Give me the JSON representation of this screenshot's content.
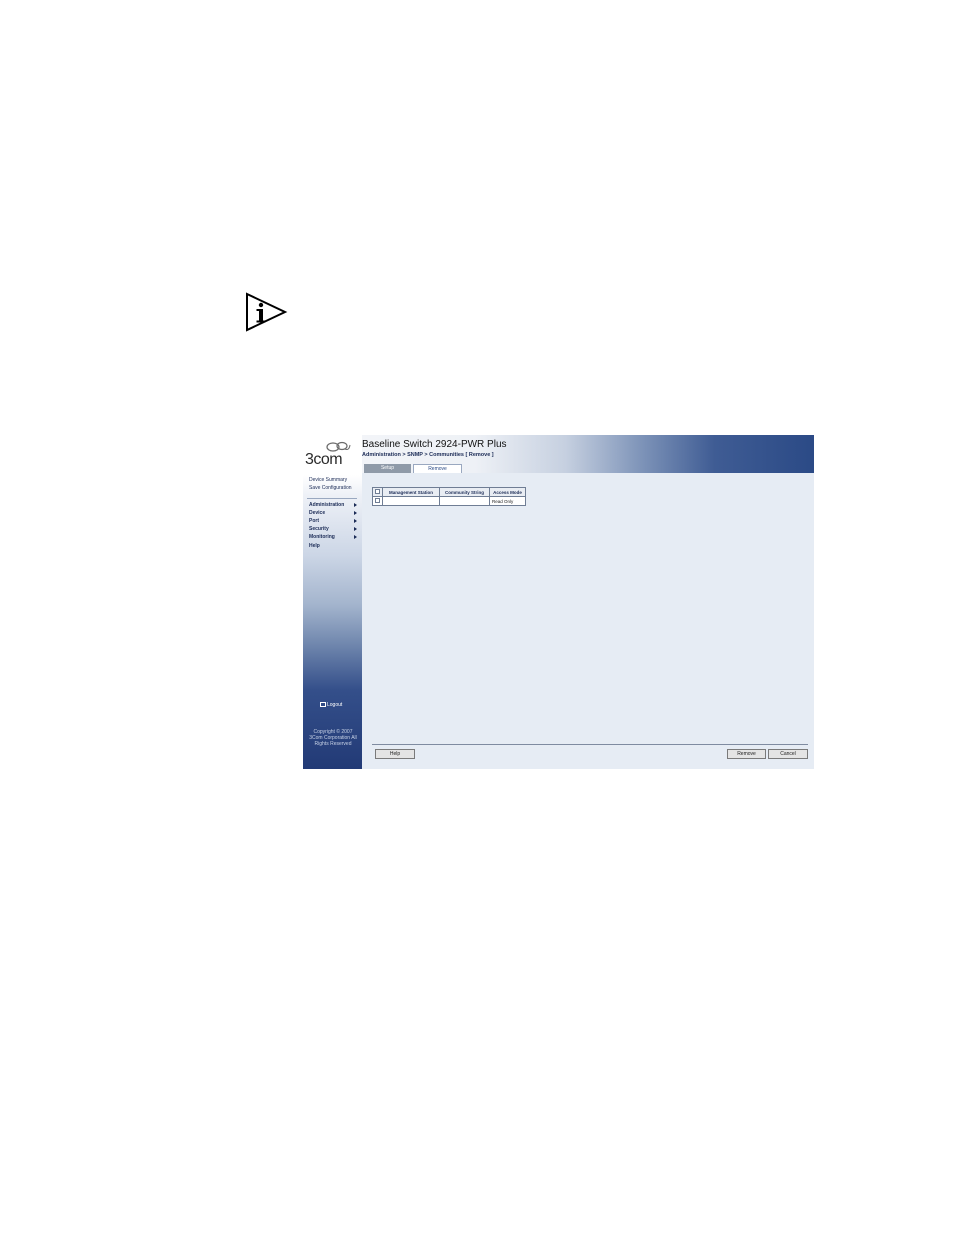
{
  "sidebar": {
    "logo_text": "3com",
    "links": [
      "Device Summary",
      "Save Configuration"
    ],
    "items": [
      {
        "label": "Administration"
      },
      {
        "label": "Device"
      },
      {
        "label": "Port"
      },
      {
        "label": "Security"
      },
      {
        "label": "Monitoring"
      },
      {
        "label": "Help"
      }
    ],
    "logout": "Logout",
    "copyright": "Copyright © 2007 3Com Corporation All Rights Reserved"
  },
  "header": {
    "title": "Baseline Switch 2924-PWR Plus",
    "breadcrumb": "Administration > SNMP > Communities [ Remove ]"
  },
  "tabs": [
    {
      "label": "Setup",
      "active": false
    },
    {
      "label": "Remove",
      "active": true
    }
  ],
  "table": {
    "columns": [
      "Management Station",
      "Community String",
      "Access Mode"
    ],
    "rows": [
      {
        "management_station": "",
        "community_string": "",
        "access_mode": "Read Only"
      }
    ]
  },
  "buttons": {
    "help": "Help",
    "remove": "Remove",
    "cancel": "Cancel"
  },
  "colors": {
    "brand_navy": "#223a76",
    "panel_bg": "#e6ecf4"
  }
}
